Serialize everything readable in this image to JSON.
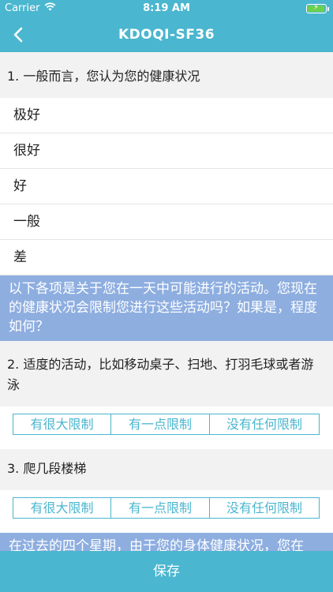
{
  "status_bar": {
    "carrier": "Carrier",
    "time": "8:19 AM"
  },
  "nav": {
    "title": "KDOQI-SF36"
  },
  "q1": {
    "text": "1. 一般而言，您认为您的健康状况",
    "options": [
      "极好",
      "很好",
      "好",
      "一般",
      "差"
    ]
  },
  "section1": {
    "text": "以下各项是关于您在一天中可能进行的活动。您现在的健康状况会限制您进行这些活动吗？如果是，程度如何？"
  },
  "q2": {
    "text": "2. 适度的活动，比如移动桌子、扫地、打羽毛球或者游泳",
    "choices": [
      "有很大限制",
      "有一点限制",
      "没有任何限制"
    ]
  },
  "q3": {
    "text": "3. 爬几段楼梯",
    "choices": [
      "有很大限制",
      "有一点限制",
      "没有任何限制"
    ]
  },
  "section2": {
    "text": "在过去的四个星期，由于您的身体健康状况，您在"
  },
  "footer": {
    "save_label": "保存"
  },
  "colors": {
    "accent": "#4ab6cf",
    "banner": "#8eaee0",
    "battery": "#6bd04e"
  }
}
